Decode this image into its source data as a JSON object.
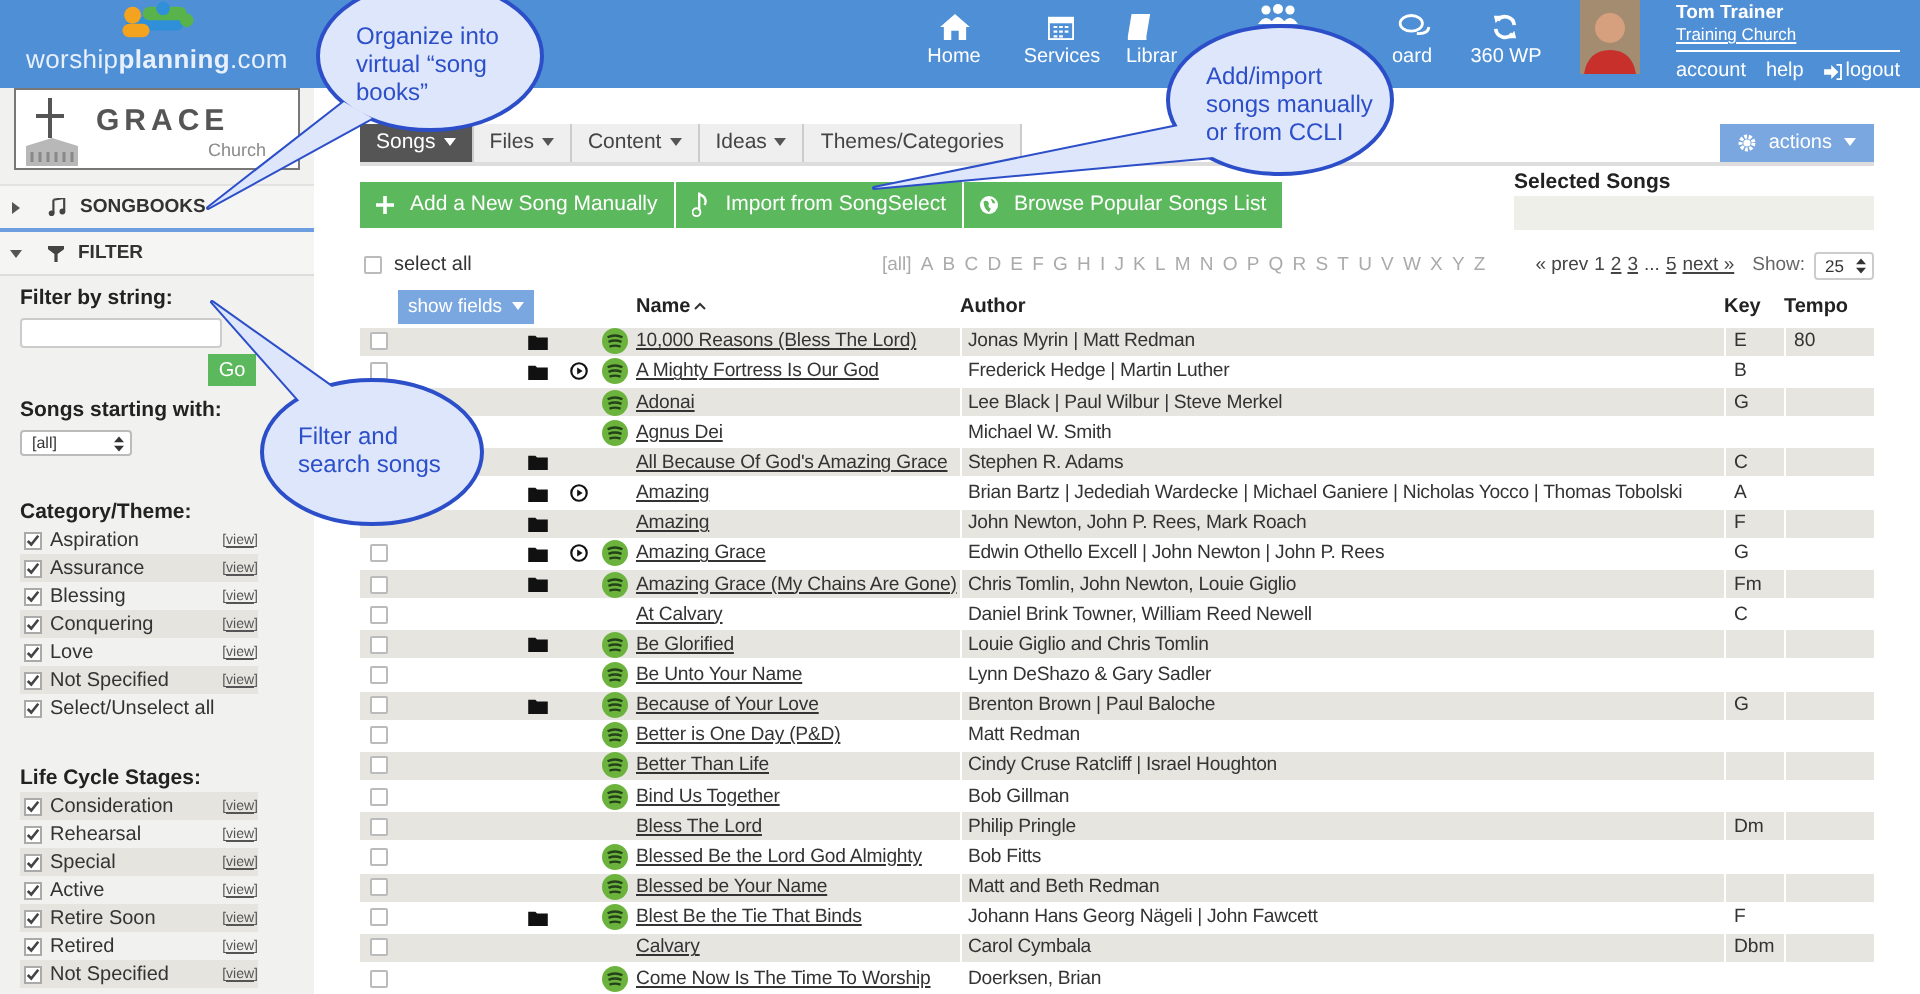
{
  "header": {
    "logo": "worship**planning**.com",
    "nav": [
      {
        "label": "Home",
        "kind": "home"
      },
      {
        "label": "Services",
        "kind": "calendar"
      },
      {
        "label": "Librar",
        "kind": "book"
      },
      {
        "kind": "people"
      },
      {
        "label": "oard",
        "kind": "chat"
      },
      {
        "label": "360 WP",
        "kind": "sync"
      }
    ],
    "user": {
      "name": "Tom Trainer",
      "church": "Training Church",
      "links": [
        {
          "label": "account",
          "kind": "text"
        },
        {
          "label": "help",
          "kind": "text"
        },
        {
          "label": "logout",
          "kind": "logout"
        }
      ]
    }
  },
  "sidebar": {
    "church_logo": {
      "name": "GRACE",
      "sub": "Church"
    },
    "sections": [
      {
        "label": "SONGBOOKS",
        "kind": "music",
        "expanded": false
      },
      {
        "label": "FILTER",
        "kind": "filter",
        "expanded": true
      }
    ],
    "filter": {
      "label": "Filter by string:",
      "button": "Go",
      "starting_label": "Songs starting with:",
      "starting_value": "[all]"
    },
    "groups": [
      {
        "title": "Category/Theme:",
        "items": [
          {
            "label": "Aspiration",
            "checked": true,
            "link": "[view]"
          },
          {
            "label": "Assurance",
            "checked": true,
            "link": "[view]"
          },
          {
            "label": "Blessing",
            "checked": true,
            "link": "[view]"
          },
          {
            "label": "Conquering",
            "checked": true,
            "link": "[view]"
          },
          {
            "label": "Love",
            "checked": true,
            "link": "[view]"
          },
          {
            "label": "Not Specified",
            "checked": true,
            "link": "[view]"
          },
          {
            "label": "Select/Unselect all",
            "checked": true
          }
        ]
      },
      {
        "title": "Life Cycle Stages:",
        "items": [
          {
            "label": "Consideration",
            "checked": true,
            "link": "[view]"
          },
          {
            "label": "Rehearsal",
            "checked": true,
            "link": "[view]"
          },
          {
            "label": "Special",
            "checked": true,
            "link": "[view]"
          },
          {
            "label": "Active",
            "checked": true,
            "link": "[view]"
          },
          {
            "label": "Retire Soon",
            "checked": true,
            "link": "[view]"
          },
          {
            "label": "Retired",
            "checked": true,
            "link": "[view]"
          },
          {
            "label": "Not Specified",
            "checked": true,
            "link": "[view]"
          }
        ]
      }
    ]
  },
  "main": {
    "tabs": [
      {
        "label": "Songs",
        "selected": true,
        "dropdown": true
      },
      {
        "label": "Files",
        "selected": false,
        "dropdown": true
      },
      {
        "label": "Content",
        "selected": false,
        "dropdown": true
      },
      {
        "label": "Ideas",
        "selected": false,
        "dropdown": true
      },
      {
        "label": "Themes/Categories",
        "selected": false,
        "dropdown": false
      }
    ],
    "actions": "actions",
    "action_buttons": [
      {
        "label": "Add a New Song Manually",
        "kind": "add"
      },
      {
        "label": "Import from SongSelect",
        "kind": "import"
      },
      {
        "label": "Browse Popular Songs List",
        "kind": "browse"
      }
    ],
    "selected_songs": {
      "label": "Selected Songs"
    },
    "select_all": {
      "label": "select all",
      "checked": false
    },
    "letters": [
      "[all]",
      "A",
      "B",
      "C",
      "D",
      "E",
      "F",
      "G",
      "H",
      "I",
      "J",
      "K",
      "L",
      "M",
      "N",
      "O",
      "P",
      "Q",
      "R",
      "S",
      "T",
      "U",
      "V",
      "W",
      "X",
      "Y",
      "Z"
    ],
    "pagination": [
      {
        "label": "« prev",
        "link": false
      },
      {
        "label": "1",
        "link": false
      },
      {
        "label": "2",
        "link": true
      },
      {
        "label": "3",
        "link": true
      },
      {
        "label": "...",
        "link": false
      },
      {
        "label": "5",
        "link": true
      },
      {
        "label": "next »",
        "link": true
      }
    ],
    "show_label": "Show:",
    "show_value": "25",
    "show_fields": "show fields"
  },
  "table": {
    "columns": [
      {
        "label": "Name",
        "sorted": true
      },
      {
        "label": "Author",
        "sorted": false
      },
      {
        "label": "Key",
        "sorted": false
      },
      {
        "label": "Tempo",
        "sorted": false
      }
    ],
    "rows": [
      {
        "name": "10,000 Reasons (Bless The Lord)",
        "author": "Jonas Myrin | Matt Redman",
        "key": "E",
        "tempo": "80",
        "checked": false,
        "has_files": true,
        "has_media": false,
        "has_link": true
      },
      {
        "name": "A Mighty Fortress Is Our God",
        "author": "Frederick Hedge | Martin Luther",
        "key": "B",
        "checked": false,
        "has_files": true,
        "has_media": true,
        "has_link": true
      },
      {
        "name": "Adonai",
        "author": "Lee Black | Paul Wilbur | Steve Merkel",
        "key": "G",
        "has_files": false,
        "has_media": false,
        "has_link": true
      },
      {
        "name": "Agnus Dei",
        "author": "Michael W. Smith",
        "has_files": false,
        "has_media": false,
        "has_link": true
      },
      {
        "name": "All Because Of God's Amazing Grace",
        "author": "Stephen R. Adams",
        "key": "C",
        "has_files": true,
        "has_media": false,
        "has_link": false
      },
      {
        "name": "Amazing",
        "author": "Brian Bartz | Jedediah Wardecke | Michael Ganiere | Nicholas Yocco | Thomas Tobolski",
        "key": "A",
        "has_files": true,
        "has_media": true,
        "has_link": false
      },
      {
        "name": "Amazing",
        "author": "John Newton, John P. Rees, Mark Roach",
        "key": "F",
        "has_files": true,
        "has_media": false,
        "has_link": false
      },
      {
        "name": "Amazing Grace",
        "author": "Edwin Othello Excell | John Newton | John P. Rees",
        "key": "G",
        "checked": false,
        "has_files": true,
        "has_media": true,
        "has_link": true
      },
      {
        "name": "Amazing Grace (My Chains Are Gone)",
        "author": "Chris Tomlin, John Newton, Louie Giglio",
        "key": "Fm",
        "checked": false,
        "has_files": true,
        "has_media": false,
        "has_link": true
      },
      {
        "name": "At Calvary",
        "author": "Daniel Brink Towner, William Reed Newell",
        "key": "C",
        "checked": false,
        "has_files": false,
        "has_media": false,
        "has_link": false
      },
      {
        "name": "Be Glorified",
        "author": "Louie Giglio and Chris Tomlin",
        "checked": false,
        "has_files": true,
        "has_media": false,
        "has_link": true
      },
      {
        "name": "Be Unto Your Name",
        "author": "Lynn DeShazo & Gary Sadler",
        "checked": false,
        "has_files": false,
        "has_media": false,
        "has_link": true
      },
      {
        "name": "Because of Your Love",
        "author": "Brenton Brown | Paul Baloche",
        "key": "G",
        "checked": false,
        "has_files": true,
        "has_media": false,
        "has_link": true
      },
      {
        "name": "Better is One Day (P&D)",
        "author": "Matt Redman",
        "checked": false,
        "has_files": false,
        "has_media": false,
        "has_link": true
      },
      {
        "name": "Better Than Life",
        "author": "Cindy Cruse Ratcliff | Israel Houghton",
        "checked": false,
        "has_files": false,
        "has_media": false,
        "has_link": true
      },
      {
        "name": "Bind Us Together",
        "author": "Bob Gillman",
        "checked": false,
        "has_files": false,
        "has_media": false,
        "has_link": true
      },
      {
        "name": "Bless The Lord",
        "author": "Philip Pringle",
        "key": "Dm",
        "checked": false,
        "has_files": false,
        "has_media": false,
        "has_link": false
      },
      {
        "name": "Blessed Be the Lord God Almighty",
        "author": "Bob Fitts",
        "checked": false,
        "has_files": false,
        "has_media": false,
        "has_link": true
      },
      {
        "name": "Blessed be Your Name",
        "author": "Matt and Beth Redman",
        "checked": false,
        "has_files": false,
        "has_media": false,
        "has_link": true
      },
      {
        "name": "Blest Be the Tie That Binds",
        "author": "Johann Hans Georg Nägeli | John Fawcett",
        "key": "F",
        "checked": false,
        "has_files": true,
        "has_media": false,
        "has_link": true
      },
      {
        "name": "Calvary",
        "author": "Carol Cymbala",
        "key": "Dbm",
        "checked": false,
        "has_files": false,
        "has_media": false,
        "has_link": false
      },
      {
        "name": "Come Now Is The Time To Worship",
        "author": "Doerksen, Brian",
        "checked": false,
        "has_files": false,
        "has_media": false,
        "has_link": true
      }
    ]
  },
  "callouts": [
    {
      "text": "Organize into virtual “song books”"
    },
    {
      "text": "Add/import songs manually or from CCLI"
    },
    {
      "text": "Filter and search songs"
    }
  ]
}
